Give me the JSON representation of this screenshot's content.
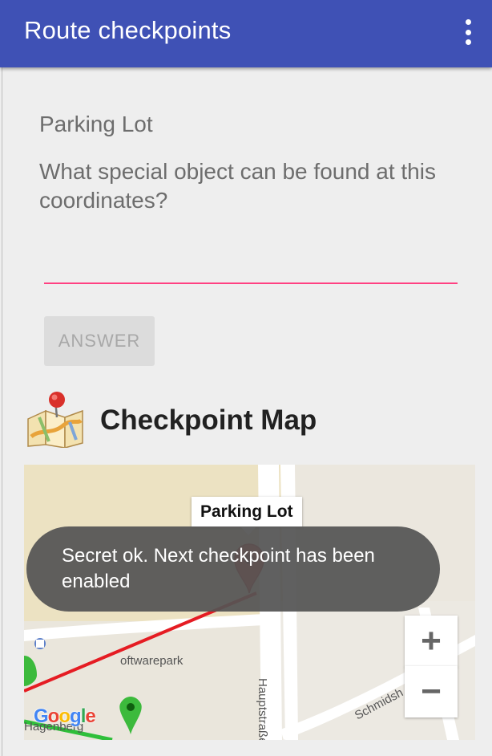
{
  "appbar": {
    "title": "Route checkpoints",
    "menu_icon": "overflow-menu-icon"
  },
  "checkpoint": {
    "title": "Parking Lot",
    "question": "What special object can be found at this coordinates?",
    "answer_value": "",
    "answer_placeholder": ""
  },
  "answer_button": {
    "label": "ANSWER",
    "enabled": false
  },
  "map_section": {
    "icon": "map-pin-icon",
    "heading": "Checkpoint Map",
    "info_window": "Parking Lot",
    "street_labels": {
      "hauptstrasse": "Hauptstraße",
      "schmiedgasse": "Schmidsh",
      "softwarepark": "oftwarepark",
      "hagenberg": "Hagenberg"
    },
    "zoom_in": "+",
    "zoom_out": "−",
    "logo_letters": [
      "G",
      "o",
      "o",
      "g",
      "l",
      "e"
    ]
  },
  "toast": {
    "message": "Secret ok. Next checkpoint has been enabled"
  },
  "colors": {
    "primary": "#3f51b5",
    "accent": "#ff4081",
    "marker": "#e53935",
    "route": "#e51c23"
  }
}
